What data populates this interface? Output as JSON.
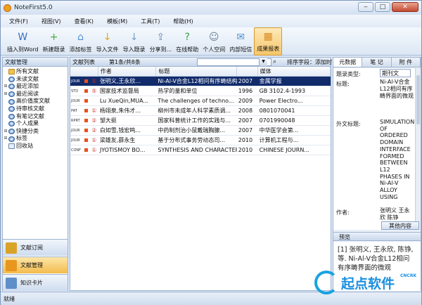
{
  "window": {
    "title": "NoteFirst5.0"
  },
  "menu": [
    "文件(F)",
    "视图(V)",
    "查看(K)",
    "模板(M)",
    "工具(T)",
    "帮助(H)"
  ],
  "toolbar": [
    {
      "label": "插入到Word",
      "icon": "insert-word-icon",
      "color": "#3a6fc4"
    },
    {
      "label": "新建题录",
      "icon": "new-record-icon",
      "color": "#4caa3c"
    },
    {
      "label": "添加标签",
      "icon": "tag-icon",
      "color": "#4f8fd8"
    },
    {
      "label": "导入文件",
      "icon": "import-file-icon",
      "color": "#e6a81a"
    },
    {
      "label": "导入题录",
      "icon": "import-record-icon",
      "color": "#78a0c8"
    },
    {
      "label": "分享到...",
      "icon": "share-icon",
      "color": "#6f8fb8"
    },
    {
      "label": "在线帮助",
      "icon": "help-icon",
      "color": "#3aa04a"
    },
    {
      "label": "个人空间",
      "icon": "user-space-icon",
      "color": "#6a7f9a"
    },
    {
      "label": "内部短信",
      "icon": "message-icon",
      "color": "#4b8fd0"
    },
    {
      "label": "成果报表",
      "icon": "report-icon",
      "color": "#d88a22"
    }
  ],
  "left": {
    "title": "文献管理",
    "tree": [
      {
        "label": "所有文献",
        "toggle": "",
        "icon": "book"
      },
      {
        "label": "未读文献",
        "toggle": "",
        "icon": "circle"
      },
      {
        "label": "最近添加",
        "toggle": "+",
        "icon": "circle"
      },
      {
        "label": "最近阅读",
        "toggle": "+",
        "icon": "circle"
      },
      {
        "label": "高价值度文献",
        "toggle": "",
        "icon": "circle"
      },
      {
        "label": "待审核文献",
        "toggle": "",
        "icon": "circle"
      },
      {
        "label": "有笔记文献",
        "toggle": "",
        "icon": "circle"
      },
      {
        "label": "个人成果",
        "toggle": "",
        "icon": "circle"
      },
      {
        "label": "快捷分类",
        "toggle": "+",
        "icon": "circle"
      },
      {
        "label": "标签",
        "toggle": "+",
        "icon": "circle"
      },
      {
        "label": "回收站",
        "toggle": "",
        "icon": "square"
      }
    ],
    "nav": [
      "文献订阅",
      "文献管理",
      "知识卡片"
    ]
  },
  "list": {
    "title": "文献列表",
    "page": "第1条/共8条",
    "sort_label": "排序字段：添加时",
    "headers": [
      "作者",
      "标题",
      "",
      "媒体"
    ],
    "rows": [
      {
        "type": "JOUR",
        "mark": "①",
        "author": "张明义,王永欣...",
        "title": "Ni-Al-V合金L12相问有序畴结构...",
        "year": "2007",
        "media": "金属学报",
        "sel": true
      },
      {
        "type": "STD",
        "mark": "⑤",
        "author": "国家技术监督局",
        "title": "热学的量和单位",
        "year": "1996",
        "media": "GB 3102.4-1993",
        "sel": false
      },
      {
        "type": "JOUR",
        "mark": "",
        "author": "Lu XueQin,MUA...",
        "title": "The challenges of techno...",
        "year": "2009",
        "media": "Power Electro...",
        "sel": false
      },
      {
        "type": "PAT",
        "mark": "①",
        "author": "杨翊泉,朱伟才...",
        "title": "柳州市未成年人科学素质调...",
        "year": "2008",
        "media": "0801070041",
        "sel": false
      },
      {
        "type": "RPRT",
        "mark": "②",
        "author": "邹大挺",
        "title": "国家科普统计工作的实践与...",
        "year": "2007",
        "media": "0701990048",
        "sel": false
      },
      {
        "type": "JOUR",
        "mark": "②",
        "author": "白如雪,钱宏鸣...",
        "title": "中药制剂治小鼠戴瑞胸腺...",
        "year": "2007",
        "media": "中华医学会第...",
        "sel": false
      },
      {
        "type": "JOUR",
        "mark": "①",
        "author": "梁雄友,薛永生",
        "title": "基于分布式事务劳动态司...",
        "year": "2010",
        "media": "计算机工程与...",
        "sel": false
      },
      {
        "type": "CONF",
        "mark": "①",
        "author": "JYOTISMOY BO...",
        "title": "SYNTHESIS AND CHARACTERI...",
        "year": "2010",
        "media": "CHINESE JOURN...",
        "sel": false
      }
    ]
  },
  "right": {
    "tabs": [
      "元数据",
      "笔 记",
      "附 件"
    ],
    "type_label": "题录类型:",
    "type_value": "期刊文",
    "title_label": "标题:",
    "title_value": "Ni-Al-V合金L12相问有序畴界面的微观",
    "ftitle_label": "外文标题:",
    "ftitle_value": "SIMULATION OF ORDERED DOMAIN INTERFACE FORMED BETWEEN L12 PHASES IN Ni-Al-V ALLOY USING",
    "author_label": "作者:",
    "author_value": "张明义 王永欣 陈铮",
    "other_btn": "其他内容",
    "preview_title": "预览",
    "preview_text": "[1] 张明义, 王永欣, 陈铮, 等. Ni-Al-V合金L12相问有序畴界面的微观"
  },
  "status": "就绪",
  "watermark": {
    "text": "起点软件",
    "sub": "CNCRK"
  }
}
